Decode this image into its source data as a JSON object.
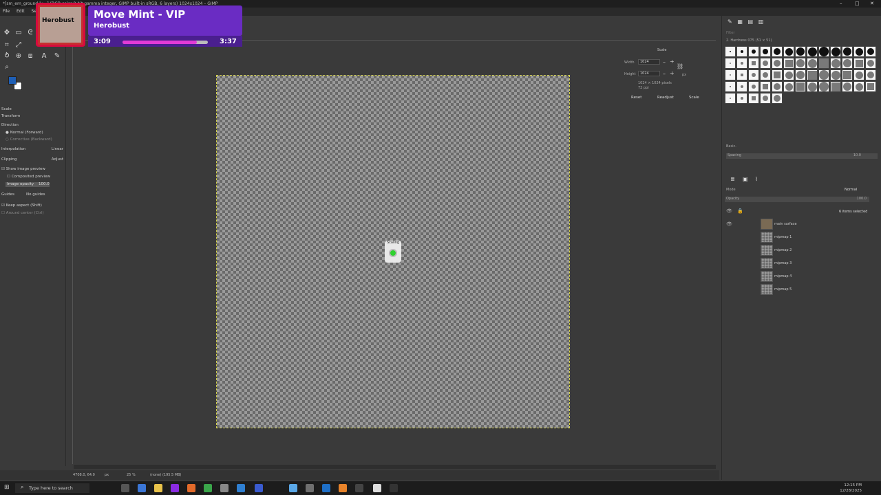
{
  "window": {
    "title": "*[sm_em_ground-lu...] (RGB color 8-bit gamma integer, GIMP built-in sRGB, 6 layers) 1024x1024 – GIMP",
    "menu": [
      "File",
      "Edit",
      "Select"
    ]
  },
  "overlay": {
    "art_text": "Herobust",
    "song": "Move Mint - VIP",
    "artist": "Herobust",
    "elapsed": "3:09",
    "total": "3:37",
    "progress": 0.87,
    "accent": "#6a2cc3"
  },
  "tool_options": {
    "title": "Scale",
    "transform_label": "Transform",
    "direction_label": "Direction",
    "direction_options": [
      "Normal (Forward)",
      "Corrective (Backward)"
    ],
    "interpolation_label": "Interpolation",
    "interpolation_value": "Linear",
    "clipping_label": "Clipping",
    "clipping_value": "Adjust",
    "show_preview": "Show image preview",
    "composited_preview": "Composited preview",
    "image_opacity_label": "Image opacity",
    "image_opacity_value": "100.0",
    "guides_label": "Guides",
    "guides_value": "No guides",
    "keep_aspect": "Keep aspect (Shift)",
    "around_center": "Around center (Ctrl)"
  },
  "scale_dialog": {
    "title": "Scale",
    "width_label": "Width",
    "width_value": "1024",
    "height_label": "Height",
    "height_value": "1024",
    "unit": "px",
    "info": "1024 × 1024 pixels",
    "info2": "72 ppi",
    "reset": "Reset",
    "readjust": "Readjust",
    "scale": "Scale"
  },
  "canvas": {
    "scaling_label": "Scaling"
  },
  "statusbar": {
    "coords": "4708.0, 64.0",
    "unit": "px",
    "zoom": "25 %",
    "info": "(none) (195.5 MB)"
  },
  "brushes": {
    "filter_placeholder": "Filter",
    "current": "2. Hardness 075 (51 × 51)",
    "preset_label": "Basic.",
    "spacing_label": "Spacing",
    "spacing_value": "10.0"
  },
  "layers": {
    "mode_label": "Mode",
    "mode_value": "Normal",
    "opacity_label": "Opacity",
    "opacity_value": "100.0",
    "selected": "6 items selected",
    "items": [
      "main surface",
      "mipmap 1",
      "mipmap 2",
      "mipmap 3",
      "mipmap 4",
      "mipmap 5"
    ]
  },
  "taskbar": {
    "search": "Type here to search",
    "time": "12:15 PM",
    "date": "12/28/2025"
  }
}
